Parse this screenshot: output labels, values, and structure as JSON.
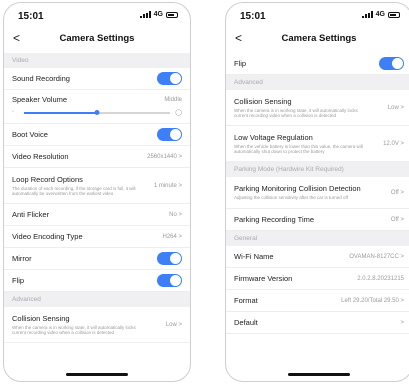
{
  "left": {
    "time": "15:01",
    "network": "4G",
    "back": "<",
    "title": "Camera Settings",
    "rows": [
      {
        "type": "section",
        "label": "Video"
      },
      {
        "type": "toggle",
        "label": "Sound Recording",
        "on": true
      },
      {
        "type": "slider",
        "label": "Speaker Volume",
        "value": "Middle",
        "level": 0.5
      },
      {
        "type": "toggle",
        "label": "Boot Voice",
        "on": true
      },
      {
        "type": "value",
        "label": "Video Resolution",
        "value": "2560x1440 >"
      },
      {
        "type": "desc",
        "label": "Loop Record Options",
        "desc": "The duration of each recording, if the storage card is full, it will automatically be overwritten from the earliest video",
        "value": "1 minute >"
      },
      {
        "type": "value",
        "label": "Anti Flicker",
        "value": "No >"
      },
      {
        "type": "value",
        "label": "Video Encoding Type",
        "value": "H264 >"
      },
      {
        "type": "toggle",
        "label": "Mirror",
        "on": true
      },
      {
        "type": "toggle",
        "label": "Flip",
        "on": true
      },
      {
        "type": "section",
        "label": "Advanced"
      },
      {
        "type": "desc",
        "label": "Collision Sensing",
        "desc": "When the camera is in working state, it will automatically locks current recording video when a collision is detected",
        "value": "Low >"
      }
    ]
  },
  "right": {
    "time": "15:01",
    "network": "4G",
    "back": "<",
    "title": "Camera Settings",
    "rows": [
      {
        "type": "toggle",
        "label": "Flip",
        "on": true
      },
      {
        "type": "section",
        "label": "Advanced"
      },
      {
        "type": "desc",
        "label": "Collision Sensing",
        "desc": "When the camera is in working state, it will automatically locks current recording video when a collision is detected",
        "value": "Low >"
      },
      {
        "type": "desc",
        "label": "Low Voltage Regulation",
        "desc": "When the vehicle battery is lower than this value, the camera will automatically shut down to protect the battery",
        "value": "12.0V >"
      },
      {
        "type": "section",
        "label": "Parking Mode (Hardwire Kit Required)"
      },
      {
        "type": "desc",
        "label": "Parking Monitoring Collision Detection",
        "desc": "Adjusting the collision sensitivity after the car is turned off",
        "value": "Off >"
      },
      {
        "type": "value",
        "label": "Parking Recording Time",
        "value": "Off >"
      },
      {
        "type": "section",
        "label": "General"
      },
      {
        "type": "value",
        "label": "Wi-Fi Name",
        "value": "OVAMAN-8127CC >"
      },
      {
        "type": "value",
        "label": "Firmware Version",
        "value": "2.0.2.8.20231215"
      },
      {
        "type": "value",
        "label": "Format",
        "value": "Left 29.20/Total 29.50 >"
      },
      {
        "type": "value",
        "label": "Default",
        "value": ">"
      }
    ]
  },
  "colors": {
    "accent": "#3d7ff7",
    "section_bg": "#f0f0f2"
  }
}
